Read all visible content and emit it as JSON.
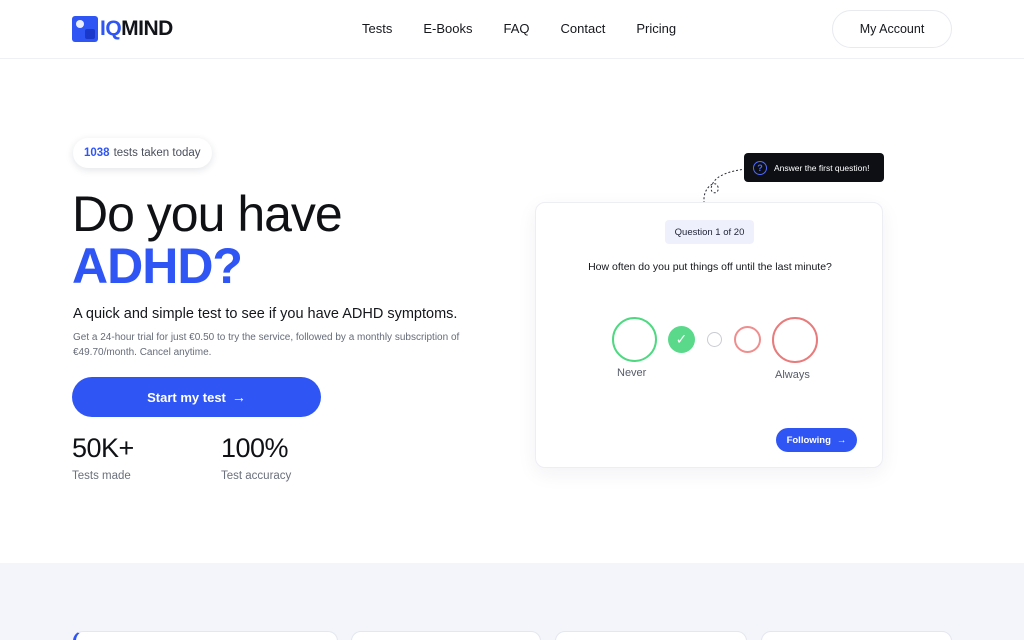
{
  "brand": {
    "logo_iq": "IQ",
    "logo_mind": "MIND",
    "accent": "#2f55f5"
  },
  "nav": {
    "items": [
      "Tests",
      "E-Books",
      "FAQ",
      "Contact",
      "Pricing"
    ]
  },
  "header": {
    "account_label": "My Account"
  },
  "hero": {
    "badge_count": "1038",
    "badge_text": "tests taken today",
    "title_line1": "Do you have",
    "title_line2": "ADHD?",
    "subtitle": "A quick and simple test to see if you have ADHD symptoms.",
    "fine_print": "Get a 24-hour trial for just €0.50 to try the service, followed by a monthly subscription of €49.70/month. Cancel anytime.",
    "cta_label": "Start my test",
    "stats": [
      {
        "value": "50K+",
        "label": "Tests made"
      },
      {
        "value": "100%",
        "label": "Test accuracy"
      }
    ]
  },
  "tooltip": {
    "icon": "question-icon",
    "text": "Answer the first question!"
  },
  "quiz_card": {
    "progress_label": "Question 1 of 20",
    "question": "How often do you put things off until the last minute?",
    "scale_left": "Never",
    "scale_right": "Always",
    "selected_option": 2,
    "next_label": "Following",
    "colors": {
      "positive": "#4fd882",
      "negative": "#e87b7b",
      "neutral": "#c9ccd4"
    }
  }
}
